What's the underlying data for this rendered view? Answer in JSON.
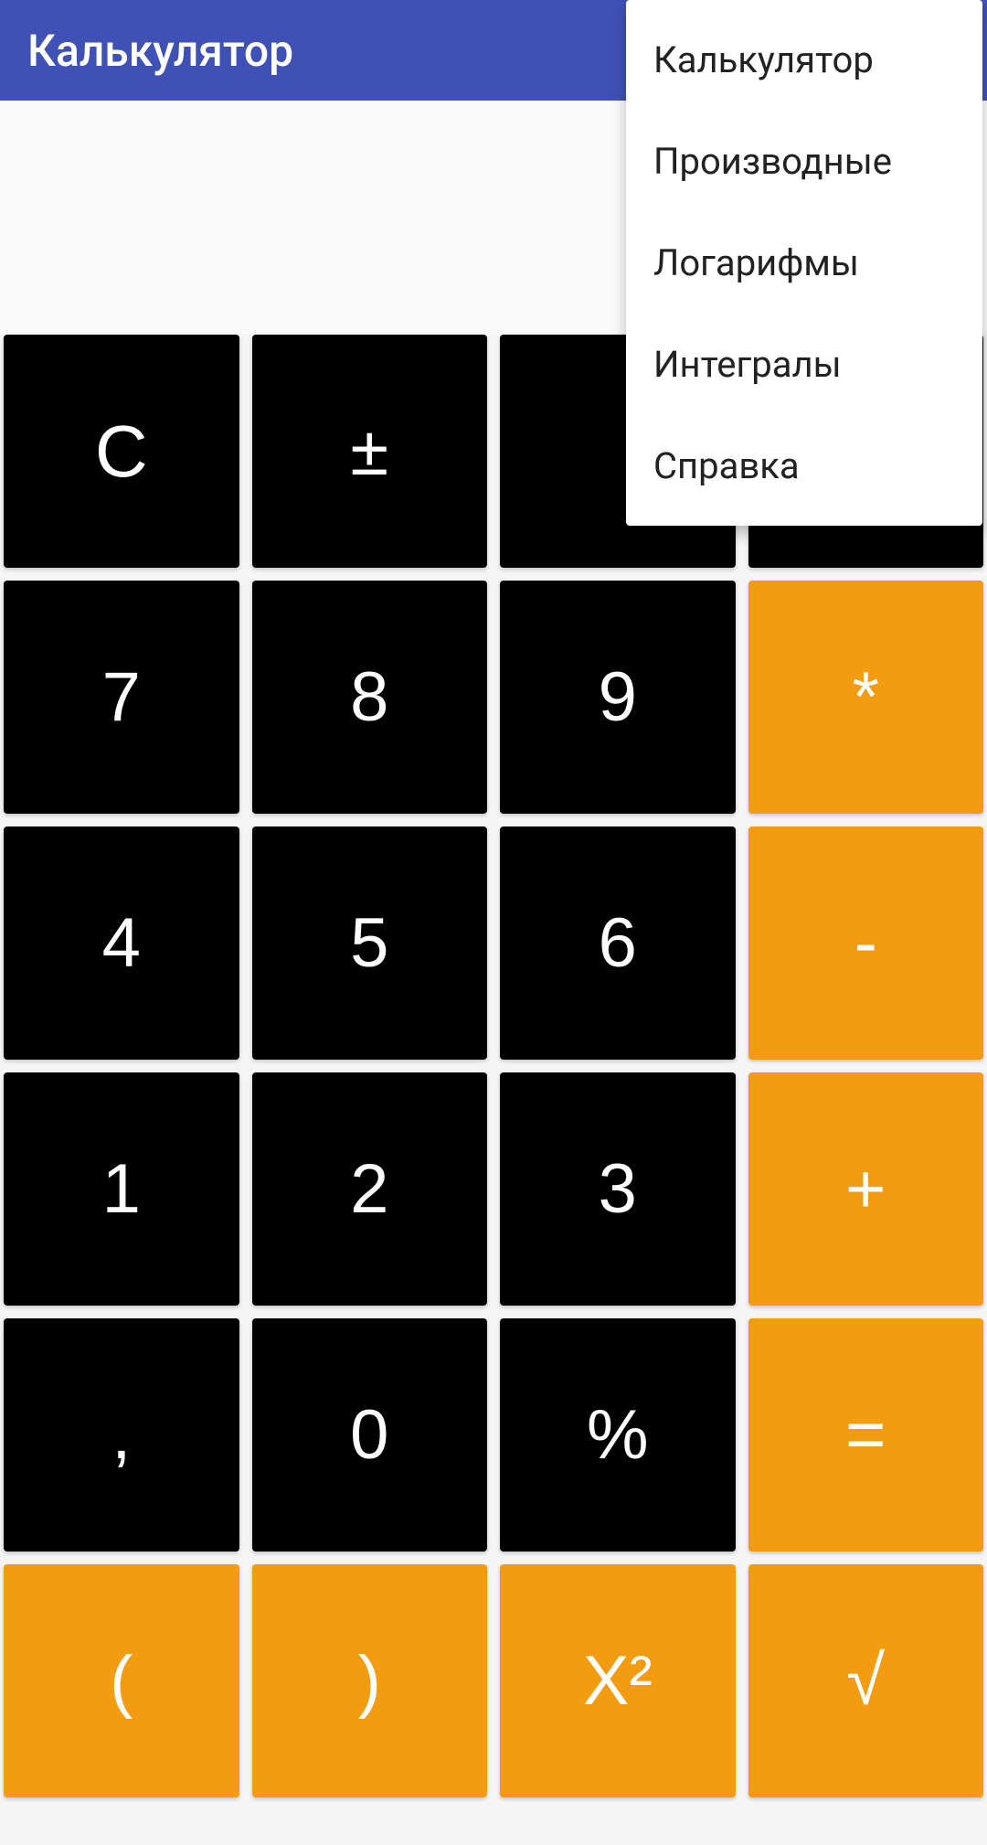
{
  "header": {
    "title": "Калькулятор"
  },
  "menu": {
    "items": [
      "Калькулятор",
      "Производные",
      "Логарифмы",
      "Интегралы",
      "Справка"
    ]
  },
  "keypad": {
    "rows": [
      [
        {
          "label": "C",
          "style": "black",
          "name": "clear-button"
        },
        {
          "label": "±",
          "style": "black",
          "name": "plusminus-button"
        },
        {
          "label": "",
          "style": "black",
          "name": "hidden-button-1"
        },
        {
          "label": "",
          "style": "black",
          "name": "hidden-button-2"
        }
      ],
      [
        {
          "label": "7",
          "style": "black",
          "name": "digit-7-button"
        },
        {
          "label": "8",
          "style": "black",
          "name": "digit-8-button"
        },
        {
          "label": "9",
          "style": "black",
          "name": "digit-9-button"
        },
        {
          "label": "*",
          "style": "orange",
          "name": "multiply-button"
        }
      ],
      [
        {
          "label": "4",
          "style": "black",
          "name": "digit-4-button"
        },
        {
          "label": "5",
          "style": "black",
          "name": "digit-5-button"
        },
        {
          "label": "6",
          "style": "black",
          "name": "digit-6-button"
        },
        {
          "label": "-",
          "style": "orange",
          "name": "subtract-button"
        }
      ],
      [
        {
          "label": "1",
          "style": "black",
          "name": "digit-1-button"
        },
        {
          "label": "2",
          "style": "black",
          "name": "digit-2-button"
        },
        {
          "label": "3",
          "style": "black",
          "name": "digit-3-button"
        },
        {
          "label": "+",
          "style": "orange",
          "name": "add-button"
        }
      ],
      [
        {
          "label": ",",
          "style": "black",
          "name": "decimal-button"
        },
        {
          "label": "0",
          "style": "black",
          "name": "digit-0-button"
        },
        {
          "label": "%",
          "style": "black",
          "name": "percent-button"
        },
        {
          "label": "=",
          "style": "orange",
          "name": "equals-button"
        }
      ],
      [
        {
          "label": "(",
          "style": "orange",
          "name": "left-paren-button"
        },
        {
          "label": ")",
          "style": "orange",
          "name": "right-paren-button"
        },
        {
          "label": "X²",
          "style": "orange",
          "name": "square-button"
        },
        {
          "label": "√",
          "style": "orange",
          "name": "sqrt-button"
        }
      ]
    ]
  }
}
